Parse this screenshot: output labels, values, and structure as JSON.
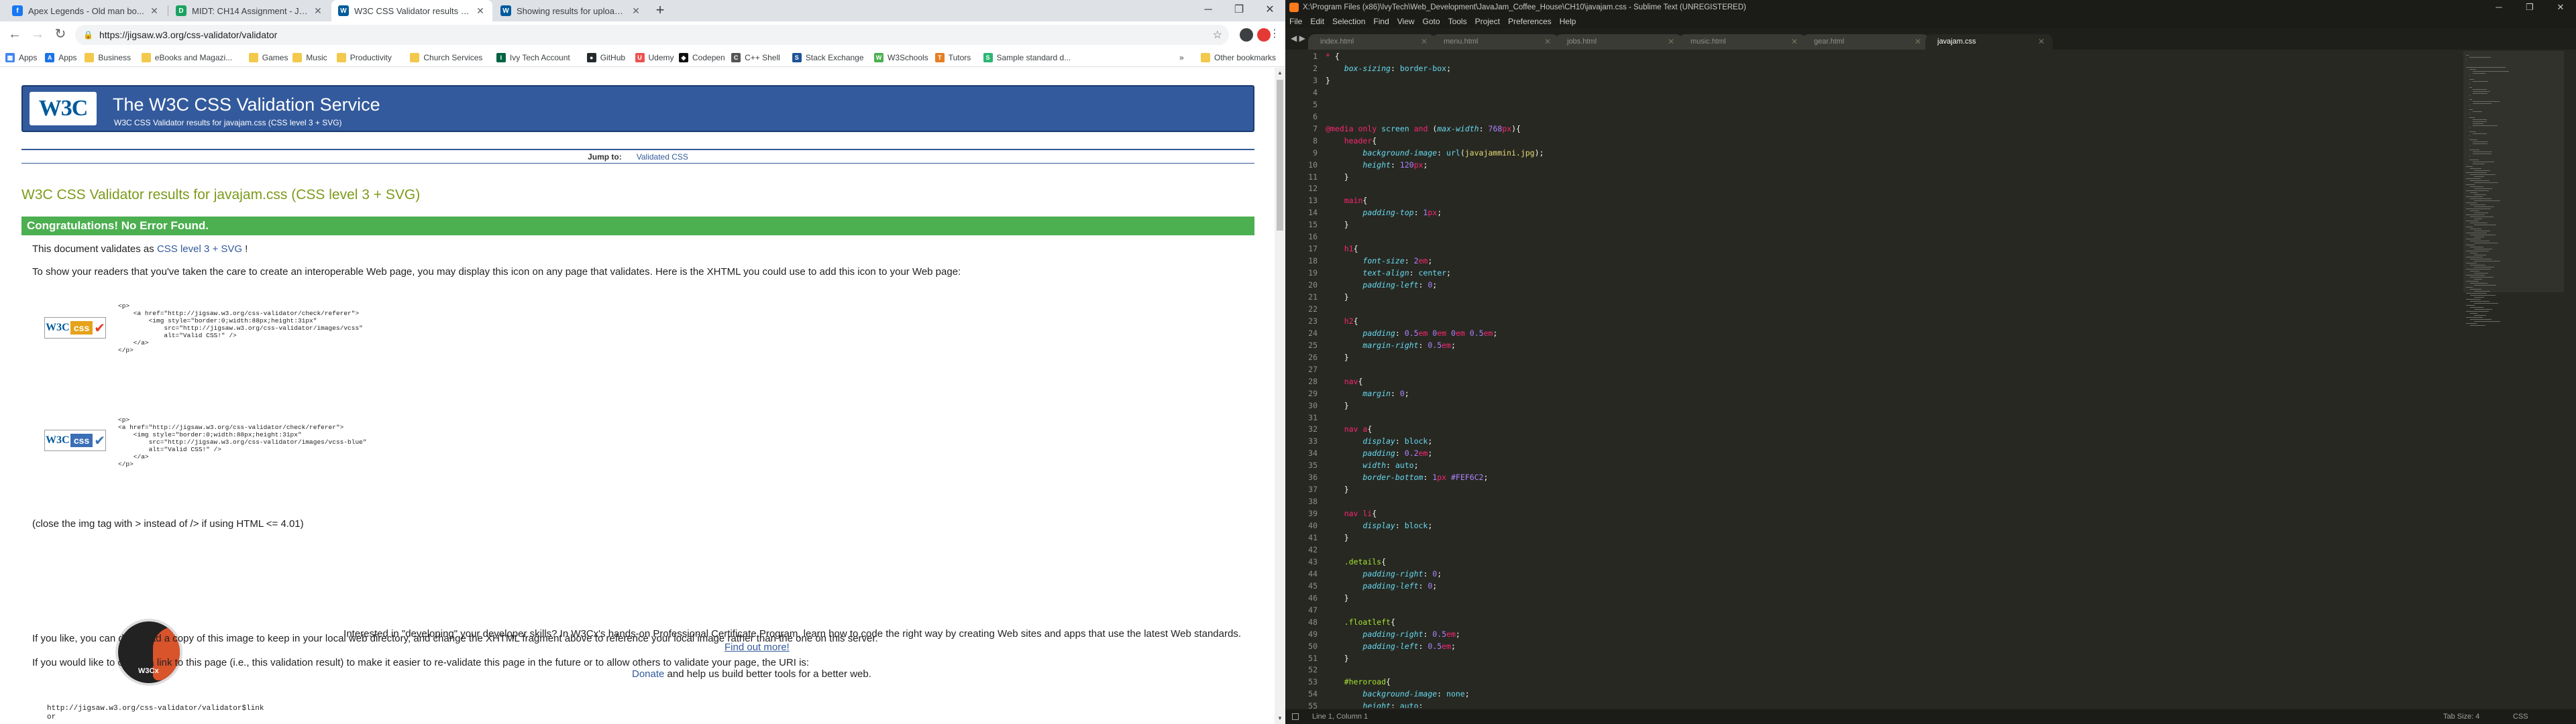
{
  "chrome": {
    "tabs": [
      {
        "label": "Apex Legends - Old man bo...",
        "favicon_color": "#1877f2",
        "favicon_text": "f"
      },
      {
        "label": "MIDT: CH14 Assignment - Javascr...",
        "favicon_color": "#1aa260",
        "favicon_text": "D"
      },
      {
        "label": "W3C CSS Validator results for ja...",
        "favicon_color": "#005a9c",
        "favicon_text": "W"
      },
      {
        "label": "Showing results for uploaded fil...",
        "favicon_color": "#005a9c",
        "favicon_text": "W"
      }
    ],
    "url": "https://jigsaw.w3.org/css-validator/validator",
    "bookmarks": [
      {
        "label": "Apps",
        "color": "#4285f4",
        "glyph": "▦"
      },
      {
        "label": "Apps",
        "color": "#1a73e8",
        "glyph": "A"
      },
      {
        "label": "Business",
        "color": "folder",
        "glyph": ""
      },
      {
        "label": "eBooks and Magazi...",
        "color": "folder",
        "glyph": ""
      },
      {
        "label": "Games",
        "color": "folder",
        "glyph": ""
      },
      {
        "label": "Music",
        "color": "folder",
        "glyph": ""
      },
      {
        "label": "Productivity",
        "color": "folder",
        "glyph": ""
      },
      {
        "label": "Church Services",
        "color": "folder",
        "glyph": ""
      },
      {
        "label": "Ivy Tech Account",
        "color": "#006341",
        "glyph": "I"
      },
      {
        "label": "GitHub",
        "color": "#24292e",
        "glyph": "●"
      },
      {
        "label": "Udemy",
        "color": "#ec5252",
        "glyph": "U"
      },
      {
        "label": "Codepen",
        "color": "#111111",
        "glyph": "◆"
      },
      {
        "label": "C++ Shell",
        "color": "#555555",
        "glyph": "C"
      },
      {
        "label": "Stack Exchange",
        "color": "#1e5397",
        "glyph": "S"
      },
      {
        "label": "W3Schools",
        "color": "#4caf50",
        "glyph": "W"
      },
      {
        "label": "Tutors",
        "color": "#e67e22",
        "glyph": "T"
      },
      {
        "label": "Sample standard d...",
        "color": "#2bb673",
        "glyph": "S"
      }
    ],
    "more_bookmarks": "»",
    "other_bookmarks": "Other bookmarks"
  },
  "page": {
    "banner_logo": "W3C",
    "banner_title": "The W3C CSS Validation Service",
    "banner_sub": "W3C CSS Validator results for javajam.css (CSS level 3 + SVG)",
    "jump_label": "Jump to:",
    "jump_link": "Validated CSS",
    "result_title": "W3C CSS Validator results for javajam.css (CSS level 3 + SVG)",
    "congrats": "Congratulations! No Error Found.",
    "validates_pre": "This document validates as ",
    "validates_link": "CSS level 3 + SVG",
    "validates_post": " !",
    "show_readers": "To show your readers that you've taken the care to create an interoperable Web page, you may display this icon on any page that validates. Here is the XHTML you could use to add this icon to your Web page:",
    "code1": "<p>\n    <a href=\"http://jigsaw.w3.org/css-validator/check/referer\">\n        <img style=\"border:0;width:88px;height:31px\"\n            src=\"http://jigsaw.w3.org/css-validator/images/vcss\"\n            alt=\"Valid CSS!\" />\n    </a>\n</p>",
    "code2": "<p>\n<a href=\"http://jigsaw.w3.org/css-validator/check/referer\">\n    <img style=\"border:0;width:88px;height:31px\"\n        src=\"http://jigsaw.w3.org/css-validator/images/vcss-blue\"\n        alt=\"Valid CSS!\" />\n    </a>\n</p>",
    "badge_w3": "W3C",
    "badge_css": "css",
    "close_note": "(close the img tag with > instead of /> if using HTML <= 4.01)",
    "w3cx_label": "W3Cx",
    "interested": "Interested in \"developing\" your developer skills? In W3Cx's hands-on Professional Certificate Program, learn how to code the right way by creating Web sites and apps that use the latest Web standards.",
    "find_out": "Find out more!",
    "donate_link": "Donate",
    "donate_text": " and help us build better tools for a better web.",
    "copy_note": "If you like, you can download a copy of this image to keep in your local web directory, and change the XHTML fragment above to reference your local image rather than the one on this server.",
    "link_note": "If you would like to create a link to this page (i.e., this validation result) to make it easier to re-validate this page in the future or to allow others to validate your page, the URI is:",
    "uri": "http://jigsaw.w3.org/css-validator/validator$link\nor"
  },
  "sublime": {
    "title": "X:\\Program Files (x86)\\IvyTech\\Web_Development\\JavaJam_Coffee_House\\CH10\\javajam.css - Sublime Text (UNREGISTERED)",
    "menu": [
      "File",
      "Edit",
      "Selection",
      "Find",
      "View",
      "Goto",
      "Tools",
      "Project",
      "Preferences",
      "Help"
    ],
    "tabs": [
      "index.html",
      "menu.html",
      "jobs.html",
      "music.html",
      "gear.html",
      "javajam.css"
    ],
    "active_tab": 5,
    "status_position": "Line 1, Column 1",
    "status_tab": "Tab Size: 4",
    "status_syntax": "CSS",
    "lines": [
      "* {",
      "    box-sizing: border-box;",
      "}",
      "",
      "",
      "",
      "@media only screen and (max-width: 768px){",
      "    header{",
      "        background-image: url(javajammini.jpg);",
      "        height: 120px;",
      "    }",
      "",
      "    main{",
      "        padding-top: 1px;",
      "    }",
      "",
      "    h1{",
      "        font-size: 2em;",
      "        text-align: center;",
      "        padding-left: 0;",
      "    }",
      "",
      "    h2{",
      "        padding: 0.5em 0em 0em 0.5em;",
      "        margin-right: 0.5em;",
      "    }",
      "",
      "    nav{",
      "        margin: 0;",
      "    }",
      "",
      "    nav a{",
      "        display: block;",
      "        padding: 0.2em;",
      "        width: auto;",
      "        border-bottom: 1px #FEF6C2;",
      "    }",
      "",
      "    nav li{",
      "        display: block;",
      "    }",
      "",
      "    .details{",
      "        padding-right: 0;",
      "        padding-left: 0;",
      "    }",
      "",
      "    .floatleft{",
      "        padding-right: 0.5em;",
      "        padding-left: 0.5em;",
      "    }",
      "",
      "    #heroroad{",
      "        background-image: none;",
      "        height: auto;"
    ]
  }
}
